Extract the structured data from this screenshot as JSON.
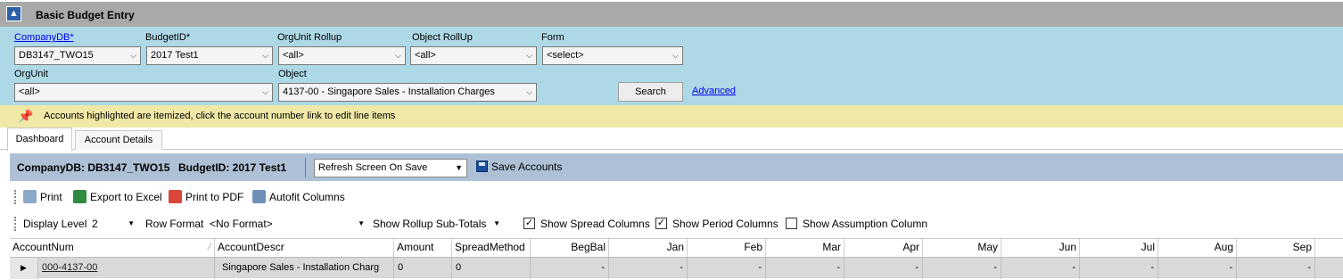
{
  "title": "Basic Budget Entry",
  "filters": {
    "company_label": "CompanyDB*",
    "company_value": "DB3147_TWO15",
    "budget_label": "BudgetID*",
    "budget_value": "2017 Test1",
    "orgrollup_label": "OrgUnit Rollup",
    "orgrollup_value": "<all>",
    "objrollup_label": "Object RollUp",
    "objrollup_value": "<all>",
    "form_label": "Form",
    "form_value": "<select>",
    "orgunit_label": "OrgUnit",
    "orgunit_value": "<all>",
    "object_label": "Object",
    "object_value": "4137-00 - Singapore Sales - Installation Charges",
    "search_label": "Search",
    "advanced_label": "Advanced"
  },
  "info_text": "Accounts highlighted are itemized, click the account number link to edit line items",
  "tabs": [
    "Dashboard",
    "Account Details"
  ],
  "header_bar": {
    "company": "CompanyDB: DB3147_TWO15",
    "budget": "BudgetID: 2017 Test1",
    "refresh": "Refresh Screen On Save",
    "save": "Save Accounts"
  },
  "toolbar1": {
    "print": "Print",
    "excel": "Export to Excel",
    "pdf": "Print to PDF",
    "autofit": "Autofit Columns"
  },
  "toolbar2": {
    "display_level_label": "Display Level",
    "display_level_value": "2",
    "row_format_label": "Row Format",
    "row_format_value": "<No Format>",
    "rollup_label": "Show Rollup Sub-Totals",
    "spread_label": "Show Spread Columns",
    "spread_checked": true,
    "period_label": "Show Period Columns",
    "period_checked": true,
    "assumption_label": "Show Assumption Column",
    "assumption_checked": false
  },
  "grid": {
    "columns": [
      "AccountNum",
      "AccountDescr",
      "Amount",
      "SpreadMethod",
      "BegBal",
      "Jan",
      "Feb",
      "Mar",
      "Apr",
      "May",
      "Jun",
      "Jul",
      "Aug",
      "Sep"
    ],
    "row": {
      "account": "000-4137-00",
      "descr": "Singapore Sales - Installation Charg",
      "amount": "0",
      "spread": "0",
      "periods": [
        "-",
        "-",
        "-",
        "-",
        "-",
        "-",
        "-",
        "-",
        "-",
        "-"
      ]
    }
  },
  "colors": {
    "filters_bg": "#add8e6",
    "info_bg": "#efe8a6",
    "header_bg": "#adc0d6",
    "title_bg": "#a9a9a9"
  }
}
